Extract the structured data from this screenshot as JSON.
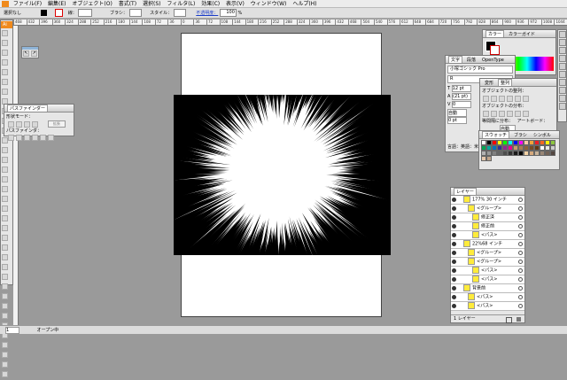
{
  "menubar": {
    "items": [
      "ファイル(F)",
      "編集(E)",
      "オブジェクト(O)",
      "書式(T)",
      "選択(S)",
      "フィルタ(L)",
      "効果(C)",
      "表示(V)",
      "ウィンドウ(W)",
      "ヘルプ(H)"
    ]
  },
  "controlbar": {
    "selection_label": "選択なし",
    "stroke_label": "線：",
    "brush_label": "ブラシ：",
    "style_label": "スタイル：",
    "opacity_label": "不透明度：",
    "opacity_value": "100",
    "percent": "%"
  },
  "ruler": {
    "ticks": [
      "468",
      "432",
      "396",
      "360",
      "324",
      "288",
      "252",
      "216",
      "180",
      "144",
      "108",
      "72",
      "36",
      "0",
      "36",
      "72",
      "108",
      "144",
      "180",
      "216",
      "252",
      "288",
      "324",
      "360",
      "396",
      "432",
      "468",
      "504",
      "540",
      "576",
      "612",
      "648",
      "684",
      "720",
      "756",
      "792",
      "828",
      "864",
      "900",
      "936",
      "972",
      "1008",
      "1044"
    ]
  },
  "pathfinder": {
    "title": "パスファインダー",
    "shape_modes_label": "形状モード：",
    "expand_button": "拡張",
    "pathfinders_label": "パスファインダ："
  },
  "color_panel": {
    "tabs": [
      "カラー",
      "カラーガイド"
    ]
  },
  "character_panel": {
    "tabs": [
      "文字",
      "段落",
      "OpenType"
    ],
    "font_family": "小塚ゴシック Pro",
    "font_style": "R",
    "font_size": "12 pt",
    "leading": "(21 pt)",
    "tracking": "0",
    "kerning": "自動",
    "baseline": "0 pt",
    "language_label": "言語：",
    "language_value": "英語：米国"
  },
  "transform_panel": {
    "tabs": [
      "変形",
      "整列"
    ],
    "align_objects_label": "オブジェクトの整列：",
    "distribute_objects_label": "オブジェクトの分布：",
    "distribute_spacing_label": "等間隔に分布：",
    "align_to_label": "アートボード：",
    "spacing_value": "自動"
  },
  "swatch_panel": {
    "tabs": [
      "スウォッチ",
      "ブラシ",
      "シンボル"
    ]
  },
  "layers_panel": {
    "tab": "レイヤー",
    "rows": [
      {
        "label": "177% 30 インチ",
        "indent": 0
      },
      {
        "label": "<グループ>",
        "indent": 1
      },
      {
        "label": "修正済",
        "indent": 2
      },
      {
        "label": "修正前",
        "indent": 2
      },
      {
        "label": "<パス>",
        "indent": 2
      },
      {
        "label": "22%68 インチ",
        "indent": 0
      },
      {
        "label": "<グループ>",
        "indent": 1
      },
      {
        "label": "<グループ>",
        "indent": 1
      },
      {
        "label": "<パス>",
        "indent": 2
      },
      {
        "label": "<パス>",
        "indent": 2
      },
      {
        "label": "背景前",
        "indent": 0
      },
      {
        "label": "<パス>",
        "indent": 1
      },
      {
        "label": "<パス>",
        "indent": 1
      }
    ],
    "footer": "1 レイヤー"
  },
  "status": {
    "zoom": "1",
    "mode": "オープン中"
  },
  "colors": {
    "accent": "#f08a1c",
    "panel": "#e6e6e6",
    "canvas_bg": "#9a9a9a"
  }
}
